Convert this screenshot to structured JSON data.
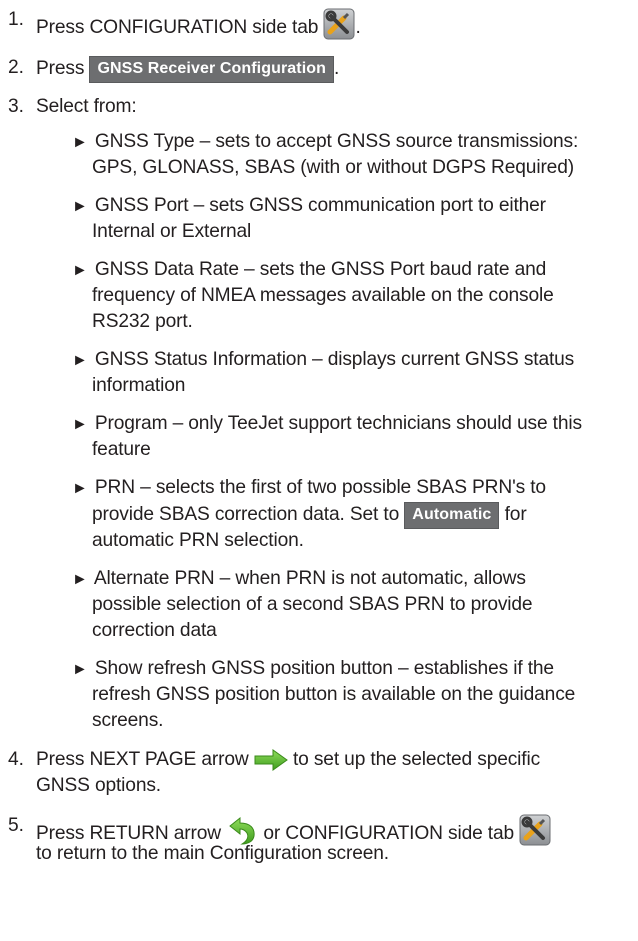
{
  "steps": {
    "s1": {
      "num": "1.",
      "pre": "Press CONFIGURATION side tab",
      "post": "."
    },
    "s2": {
      "num": "2.",
      "pre": "Press",
      "button": "GNSS Receiver Configuration",
      "post": "."
    },
    "s3": {
      "num": "3.",
      "text": "Select from:"
    },
    "s4": {
      "num": "4.",
      "pre": "Press NEXT PAGE arrow",
      "post": "to set up the selected specific",
      "l2": "GNSS options."
    },
    "s5": {
      "num": "5.",
      "pre": "Press RETURN arrow",
      "mid": "or CONFIGURATION side tab",
      "l2": "to return to the main Configuration screen."
    }
  },
  "bullet_glyph": "►",
  "bullets": {
    "b1": {
      "l1": "GNSS Type – sets to accept GNSS source transmissions:",
      "l2": "GPS, GLONASS, SBAS (with or without DGPS Required)"
    },
    "b2": {
      "l1": "GNSS Port – sets GNSS communication port to either",
      "l2": "Internal or External"
    },
    "b3": {
      "l1": "GNSS Data Rate – sets the GNSS Port baud rate and",
      "l2": "frequency of NMEA messages available on the console",
      "l3": "RS232 port."
    },
    "b4": {
      "l1": "GNSS Status Information – displays current GNSS status",
      "l2": "information"
    },
    "b5": {
      "l1": "Program – only TeeJet support technicians should use this",
      "l2": "feature"
    },
    "b6": {
      "l1": "PRN – selects the first of two possible SBAS PRN's to",
      "l2": "provide SBAS correction data. Set to",
      "button": "Automatic",
      "l2_post": "for",
      "l3": "automatic PRN selection."
    },
    "b7": {
      "l1": "Alternate PRN – when PRN is not automatic, allows",
      "l2": "possible selection of a second SBAS PRN to provide",
      "l3": "correction data"
    },
    "b8": {
      "l1": "Show refresh GNSS position button – establishes if the",
      "l2": "refresh GNSS position button is available on the guidance",
      "l3": "screens."
    }
  },
  "icons": {
    "config": "wrench-screwdriver-tools-icon",
    "next": "green-right-arrow-icon",
    "return": "green-curved-return-arrow-icon"
  },
  "colors": {
    "text": "#231f20",
    "button_bg": "#6d6e70",
    "button_text": "#ffffff",
    "arrow_green": "#57b531"
  }
}
